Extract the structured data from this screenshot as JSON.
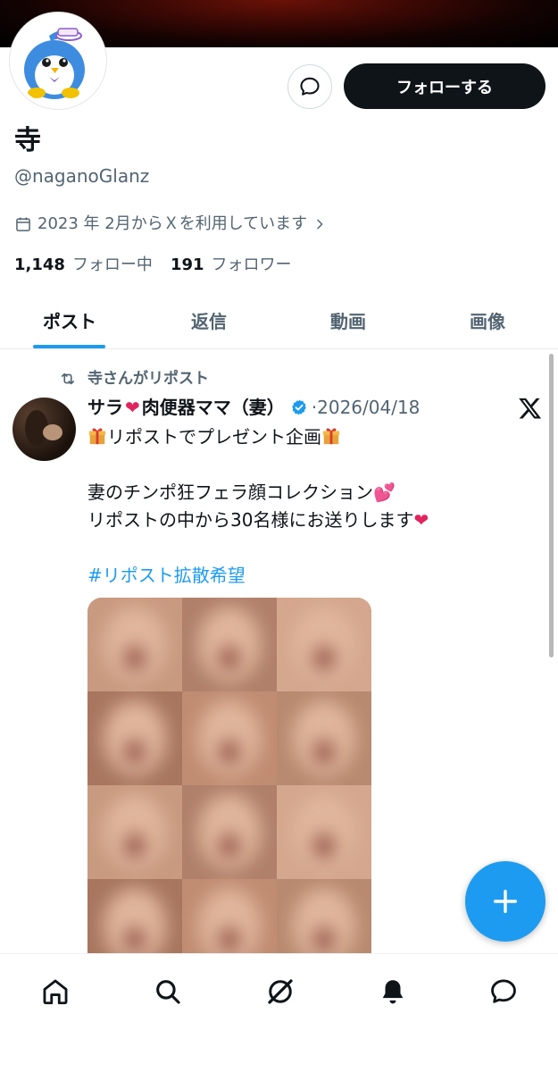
{
  "profile": {
    "name": "寺",
    "handle": "@naganoGlanz",
    "joined": "2023 年 2月からＸを利用しています",
    "following_count": "1,148",
    "following_label": "フォロー中",
    "followers_count": "191",
    "followers_label": "フォロワー"
  },
  "actions": {
    "follow_label": "フォローする",
    "message_icon": "message-bubble-icon"
  },
  "tabs": [
    {
      "label": "ポスト",
      "active": true
    },
    {
      "label": "返信",
      "active": false
    },
    {
      "label": "動画",
      "active": false
    },
    {
      "label": "画像",
      "active": false
    }
  ],
  "post": {
    "repost_label": "寺さんがリポスト",
    "author_name_part1": "サラ",
    "author_heart": "❤",
    "author_name_part2": "肉便器ママ（妻）",
    "date": "2026/04/18",
    "line1": "リポストでプレゼント企画",
    "line2": "妻のチンポ狂フェラ顔コレクション",
    "line2_emoji": "💕",
    "line3": "リポストの中から30名様にお送りします",
    "line3_emoji": "❤",
    "hashtag": "#リポスト拡散希望",
    "hashtag_color": "#1d9bf0"
  },
  "nav": [
    "home-icon",
    "search-icon",
    "grok-icon",
    "notifications-icon",
    "messages-icon"
  ],
  "colors": {
    "accent": "#1d9bf0",
    "text_primary": "#0f1419",
    "text_secondary": "#536471"
  }
}
